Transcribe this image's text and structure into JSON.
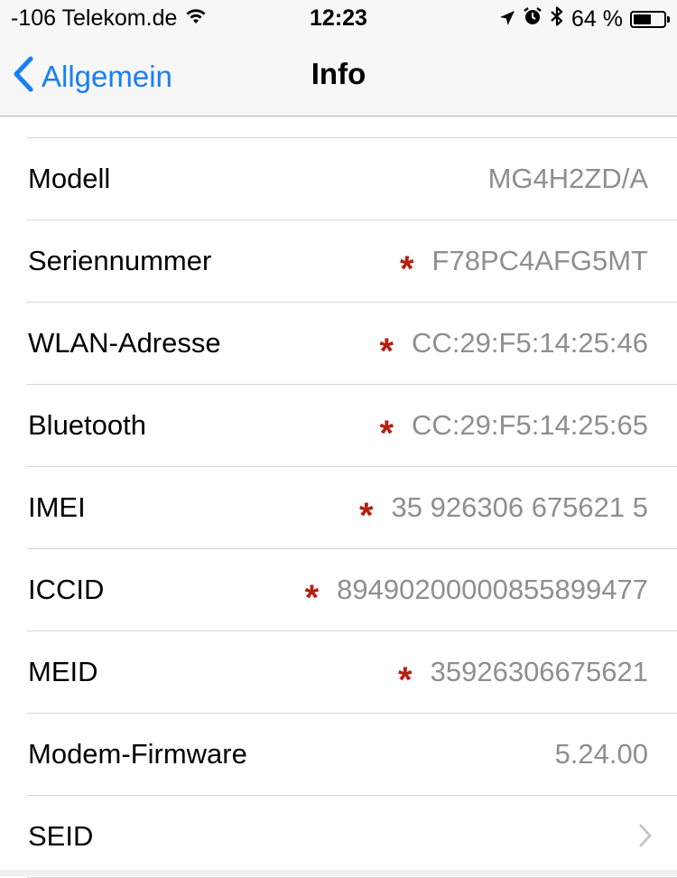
{
  "status_bar": {
    "carrier": "-106 Telekom.de",
    "time": "12:23",
    "battery_percent_text": "64 %",
    "battery_level": 0.64,
    "icons": [
      "wifi-icon",
      "location-arrow-icon",
      "alarm-clock-icon",
      "bluetooth-icon",
      "battery-icon"
    ]
  },
  "nav": {
    "back_label": "Allgemein",
    "title": "Info"
  },
  "rows": [
    {
      "label": "Modell",
      "value": "MG4H2ZD/A",
      "marked": false
    },
    {
      "label": "Seriennummer",
      "value": "F78PC4AFG5MT",
      "marked": true
    },
    {
      "label": "WLAN-Adresse",
      "value": "CC:29:F5:14:25:46",
      "marked": true
    },
    {
      "label": "Bluetooth",
      "value": "CC:29:F5:14:25:65",
      "marked": true
    },
    {
      "label": "IMEI",
      "value": "35 926306 675621 5",
      "marked": true
    },
    {
      "label": "ICCID",
      "value": "89490200000855899477",
      "marked": true
    },
    {
      "label": "MEID",
      "value": "35926306675621",
      "marked": true
    },
    {
      "label": "Modem-Firmware",
      "value": "5.24.00",
      "marked": false
    },
    {
      "label": "SEID",
      "value": "",
      "marked": false,
      "disclosure": true
    }
  ],
  "colors": {
    "accent": "#1a7ef5",
    "value_text": "#8e8e93",
    "marker": "#b42010",
    "separator": "#d6d6da"
  }
}
